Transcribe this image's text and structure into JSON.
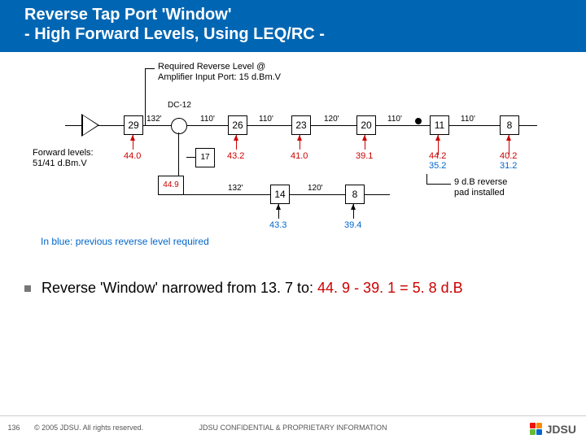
{
  "header": {
    "line1": "Reverse Tap Port 'Window'",
    "line2": "- High Forward Levels, Using LEQ/RC -"
  },
  "req_note": {
    "l1": "Required Reverse Level @",
    "l2": "Amplifier Input Port: 15 d.Bm.V"
  },
  "dc_label": "DC-12",
  "taps_top": [
    {
      "v": "29"
    },
    {
      "v": "26"
    },
    {
      "v": "23"
    },
    {
      "v": "20"
    },
    {
      "v": "11"
    },
    {
      "v": "8"
    }
  ],
  "taps_bot": [
    {
      "v": "14"
    },
    {
      "v": "8"
    }
  ],
  "eq": "17",
  "len_top": [
    "132'",
    "110'",
    "110'",
    "120'",
    "110'",
    "110'"
  ],
  "len_bot": [
    "132'",
    "120'"
  ],
  "fwd": {
    "lbl": "Forward levels:",
    "val": "51/41 d.Bm.V"
  },
  "vals_top": [
    "44.0",
    "43.2",
    "41.0",
    "39.1"
  ],
  "vals_top_r": [
    {
      "a": "44.2",
      "b": "35.2"
    },
    {
      "a": "40.2",
      "b": "31.2"
    }
  ],
  "box449": "44.9",
  "vals_bot": [
    "43.3",
    "39.4"
  ],
  "pad_note": {
    "l1": "9 d.B reverse",
    "l2": "pad installed"
  },
  "blue_note": "In blue: previous reverse level required",
  "bullet": {
    "p1": "Reverse 'Window' narrowed from 13. 7 to: ",
    "p2": "44. 9 - 39. 1 = 5. 8 d.B"
  },
  "footer": {
    "page": "136",
    "copy": "© 2005 JDSU. All rights reserved.",
    "conf": "JDSU CONFIDENTIAL & PROPRIETARY INFORMATION",
    "brand": "JDSU"
  }
}
